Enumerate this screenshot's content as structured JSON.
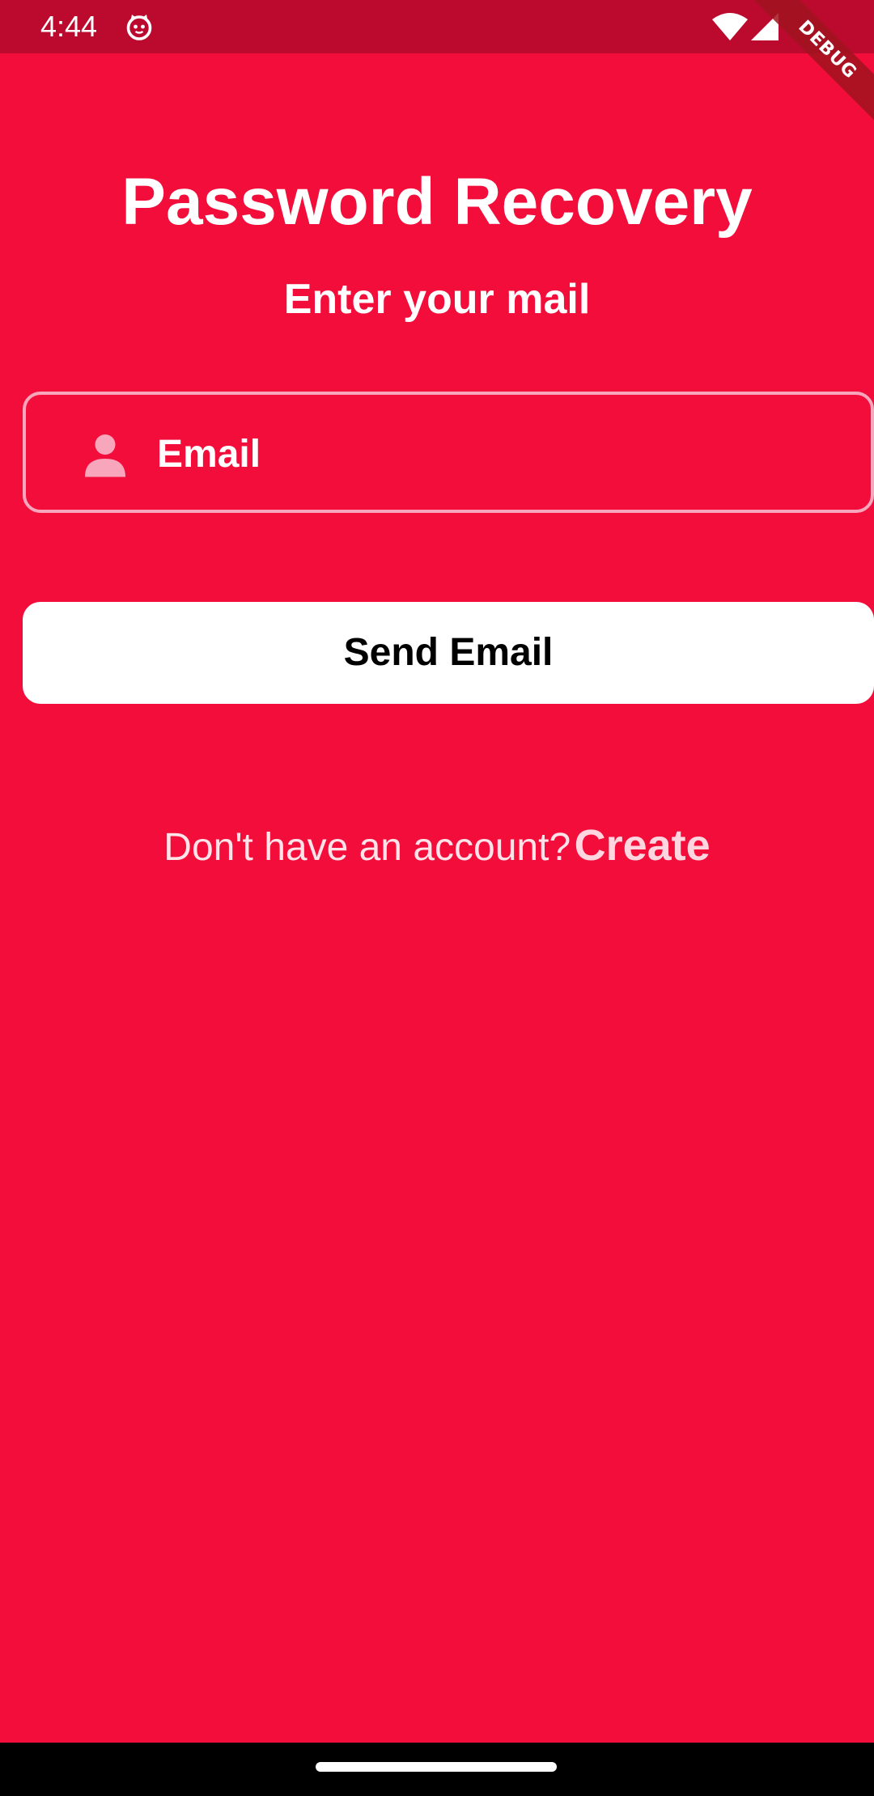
{
  "status_bar": {
    "time": "4:44",
    "notification_icon": "cat-face-icon",
    "wifi_icon": "wifi-icon",
    "signal_icon": "cellular-signal-icon"
  },
  "debug_banner": "DEBUG",
  "header": {
    "title": "Password Recovery",
    "subtitle": "Enter your mail"
  },
  "email_field": {
    "icon": "person-icon",
    "placeholder": "Email",
    "value": ""
  },
  "send_button": {
    "label": "Send Email"
  },
  "signup": {
    "prompt": "Don't have an account?",
    "link": "Create"
  },
  "colors": {
    "background": "#F20D3B",
    "status_bar": "#BB0A2E",
    "field_border": "#F7A6BC",
    "button_background": "#FFFFFF",
    "button_text": "#000000"
  }
}
